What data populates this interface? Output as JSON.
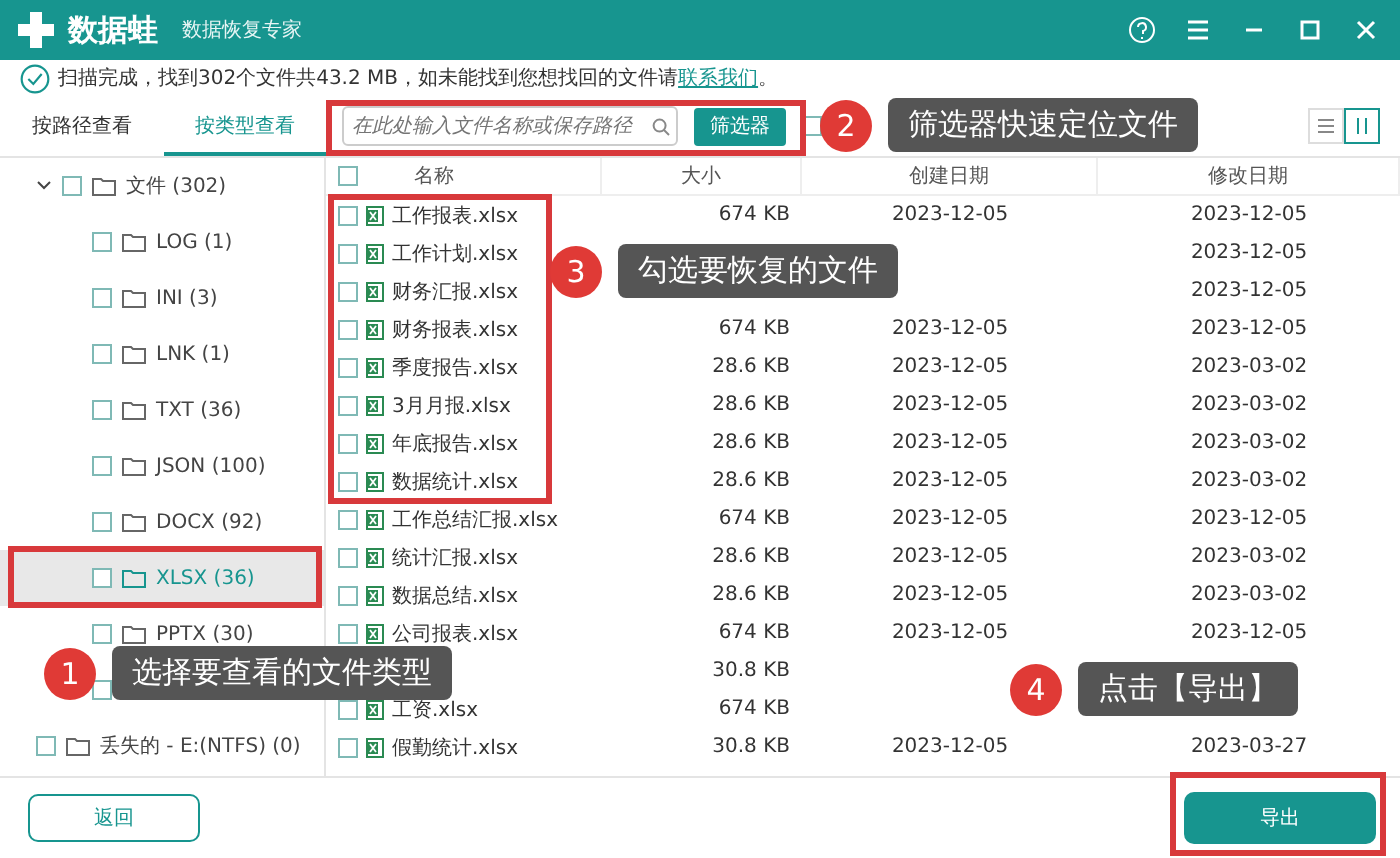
{
  "app": {
    "name": "数据蛙",
    "subtitle": "数据恢复专家"
  },
  "notice": {
    "text": "扫描完成，找到302个文件共43.2 MB，如未能找到您想找回的文件请",
    "link": "联系我们",
    "end": "。"
  },
  "view_tabs": [
    {
      "label": "按路径查看",
      "selected": false
    },
    {
      "label": "按类型查看",
      "selected": true
    }
  ],
  "search": {
    "placeholder": "在此处输入文件名称或保存路径"
  },
  "filter_button": "筛选器",
  "show_deleted": {
    "checked": false
  },
  "view_modes": [
    {
      "kind": "list",
      "selected": false
    },
    {
      "kind": "grid",
      "selected": true
    }
  ],
  "tree": [
    {
      "label": "文件 (302)",
      "checked": false,
      "selected": false,
      "expanded": true,
      "children": [
        {
          "label": "LOG (1)",
          "checked": false,
          "selected": false
        },
        {
          "label": "INI (3)",
          "checked": false,
          "selected": false
        },
        {
          "label": "LNK (1)",
          "checked": false,
          "selected": false
        },
        {
          "label": "TXT (36)",
          "checked": false,
          "selected": false
        },
        {
          "label": "JSON (100)",
          "checked": false,
          "selected": false
        },
        {
          "label": "DOCX (92)",
          "checked": false,
          "selected": false
        },
        {
          "label": "XLSX (36)",
          "checked": false,
          "selected": true
        },
        {
          "label": "PPTX (30)",
          "checked": false,
          "selected": false
        },
        {
          "checked": false,
          "selected": false
        }
      ]
    },
    {
      "label": "丢失的 - E:(NTFS) (0)",
      "checked": false,
      "selected": false,
      "expanded": false
    }
  ],
  "table": {
    "all_checked": false,
    "columns": [
      "名称",
      "大小",
      "创建日期",
      "修改日期"
    ],
    "rows": [
      {
        "name": "工作报表.xlsx",
        "size": "674 KB",
        "created": "2023-12-05",
        "modified": "2023-12-05",
        "checked": false
      },
      {
        "name": "工作计划.xlsx",
        "modified": "2023-12-05",
        "checked": false
      },
      {
        "name": "财务汇报.xlsx",
        "modified": "2023-12-05",
        "checked": false
      },
      {
        "name": "财务报表.xlsx",
        "size": "674 KB",
        "created": "2023-12-05",
        "modified": "2023-12-05",
        "checked": false
      },
      {
        "name": "季度报告.xlsx",
        "size": "28.6 KB",
        "created": "2023-12-05",
        "modified": "2023-03-02",
        "checked": false
      },
      {
        "name": "3月月报.xlsx",
        "size": "28.6 KB",
        "created": "2023-12-05",
        "modified": "2023-03-02",
        "checked": false
      },
      {
        "name": "年底报告.xlsx",
        "size": "28.6 KB",
        "created": "2023-12-05",
        "modified": "2023-03-02",
        "checked": false
      },
      {
        "name": "数据统计.xlsx",
        "size": "28.6 KB",
        "created": "2023-12-05",
        "modified": "2023-03-02",
        "checked": false
      },
      {
        "name": "工作总结汇报.xlsx",
        "size": "674 KB",
        "created": "2023-12-05",
        "modified": "2023-12-05",
        "checked": false
      },
      {
        "name": "统计汇报.xlsx",
        "size": "28.6 KB",
        "created": "2023-12-05",
        "modified": "2023-03-02",
        "checked": false
      },
      {
        "name": "数据总结.xlsx",
        "size": "28.6 KB",
        "created": "2023-12-05",
        "modified": "2023-03-02",
        "checked": false
      },
      {
        "name": "公司报表.xlsx",
        "size": "674 KB",
        "created": "2023-12-05",
        "modified": "2023-12-05",
        "checked": false
      },
      {
        "size": "30.8 KB"
      },
      {
        "name": "工资.xlsx",
        "size": "674 KB",
        "checked": false
      },
      {
        "name": "假勤统计.xlsx",
        "size": "30.8 KB",
        "created": "2023-12-05",
        "modified": "2023-03-27",
        "checked": false
      }
    ]
  },
  "buttons": {
    "back": "返回",
    "export": "导出"
  },
  "callouts": [
    {
      "number": "1",
      "text": "选择要查看的文件类型"
    },
    {
      "number": "2",
      "text": "筛选器快速定位文件"
    },
    {
      "number": "3",
      "text": "勾选要恢复的文件"
    },
    {
      "number": "4",
      "text": "点击【导出】"
    }
  ]
}
